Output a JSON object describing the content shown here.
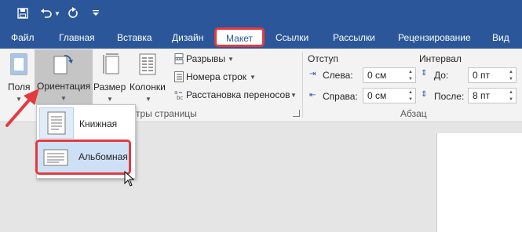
{
  "quick_access": {
    "save_icon": "save-icon",
    "undo_icon": "undo-icon",
    "redo_icon": "redo-icon",
    "customize_icon": "customize-icon"
  },
  "tabs": [
    {
      "label": "Файл"
    },
    {
      "label": "Главная"
    },
    {
      "label": "Вставка"
    },
    {
      "label": "Дизайн"
    },
    {
      "label": "Макет"
    },
    {
      "label": "Ссылки"
    },
    {
      "label": "Рассылки"
    },
    {
      "label": "Рецензирование"
    },
    {
      "label": "Вид"
    }
  ],
  "ribbon": {
    "page_setup": {
      "margins_label": "Поля",
      "orientation_label": "Ориентация",
      "size_label": "Размер",
      "columns_label": "Колонки",
      "breaks_label": "Разрывы",
      "line_numbers_label": "Номера строк",
      "hyphenation_label": "Расстановка переносов",
      "group_label": "тры страницы"
    },
    "paragraph": {
      "indent_header": "Отступ",
      "left_label": "Слева:",
      "left_value": "0 см",
      "right_label": "Справа:",
      "right_value": "0 см",
      "spacing_header": "Интервал",
      "before_label": "До:",
      "before_value": "0 пт",
      "after_label": "После:",
      "after_value": "8 пт",
      "group_label": "Абзац"
    }
  },
  "orientation_menu": {
    "portrait_label": "Книжная",
    "landscape_label": "Альбомная"
  },
  "colors": {
    "word_blue": "#2b579a",
    "highlight_red": "#e33a3f",
    "selected_bg": "#cde0f5"
  }
}
